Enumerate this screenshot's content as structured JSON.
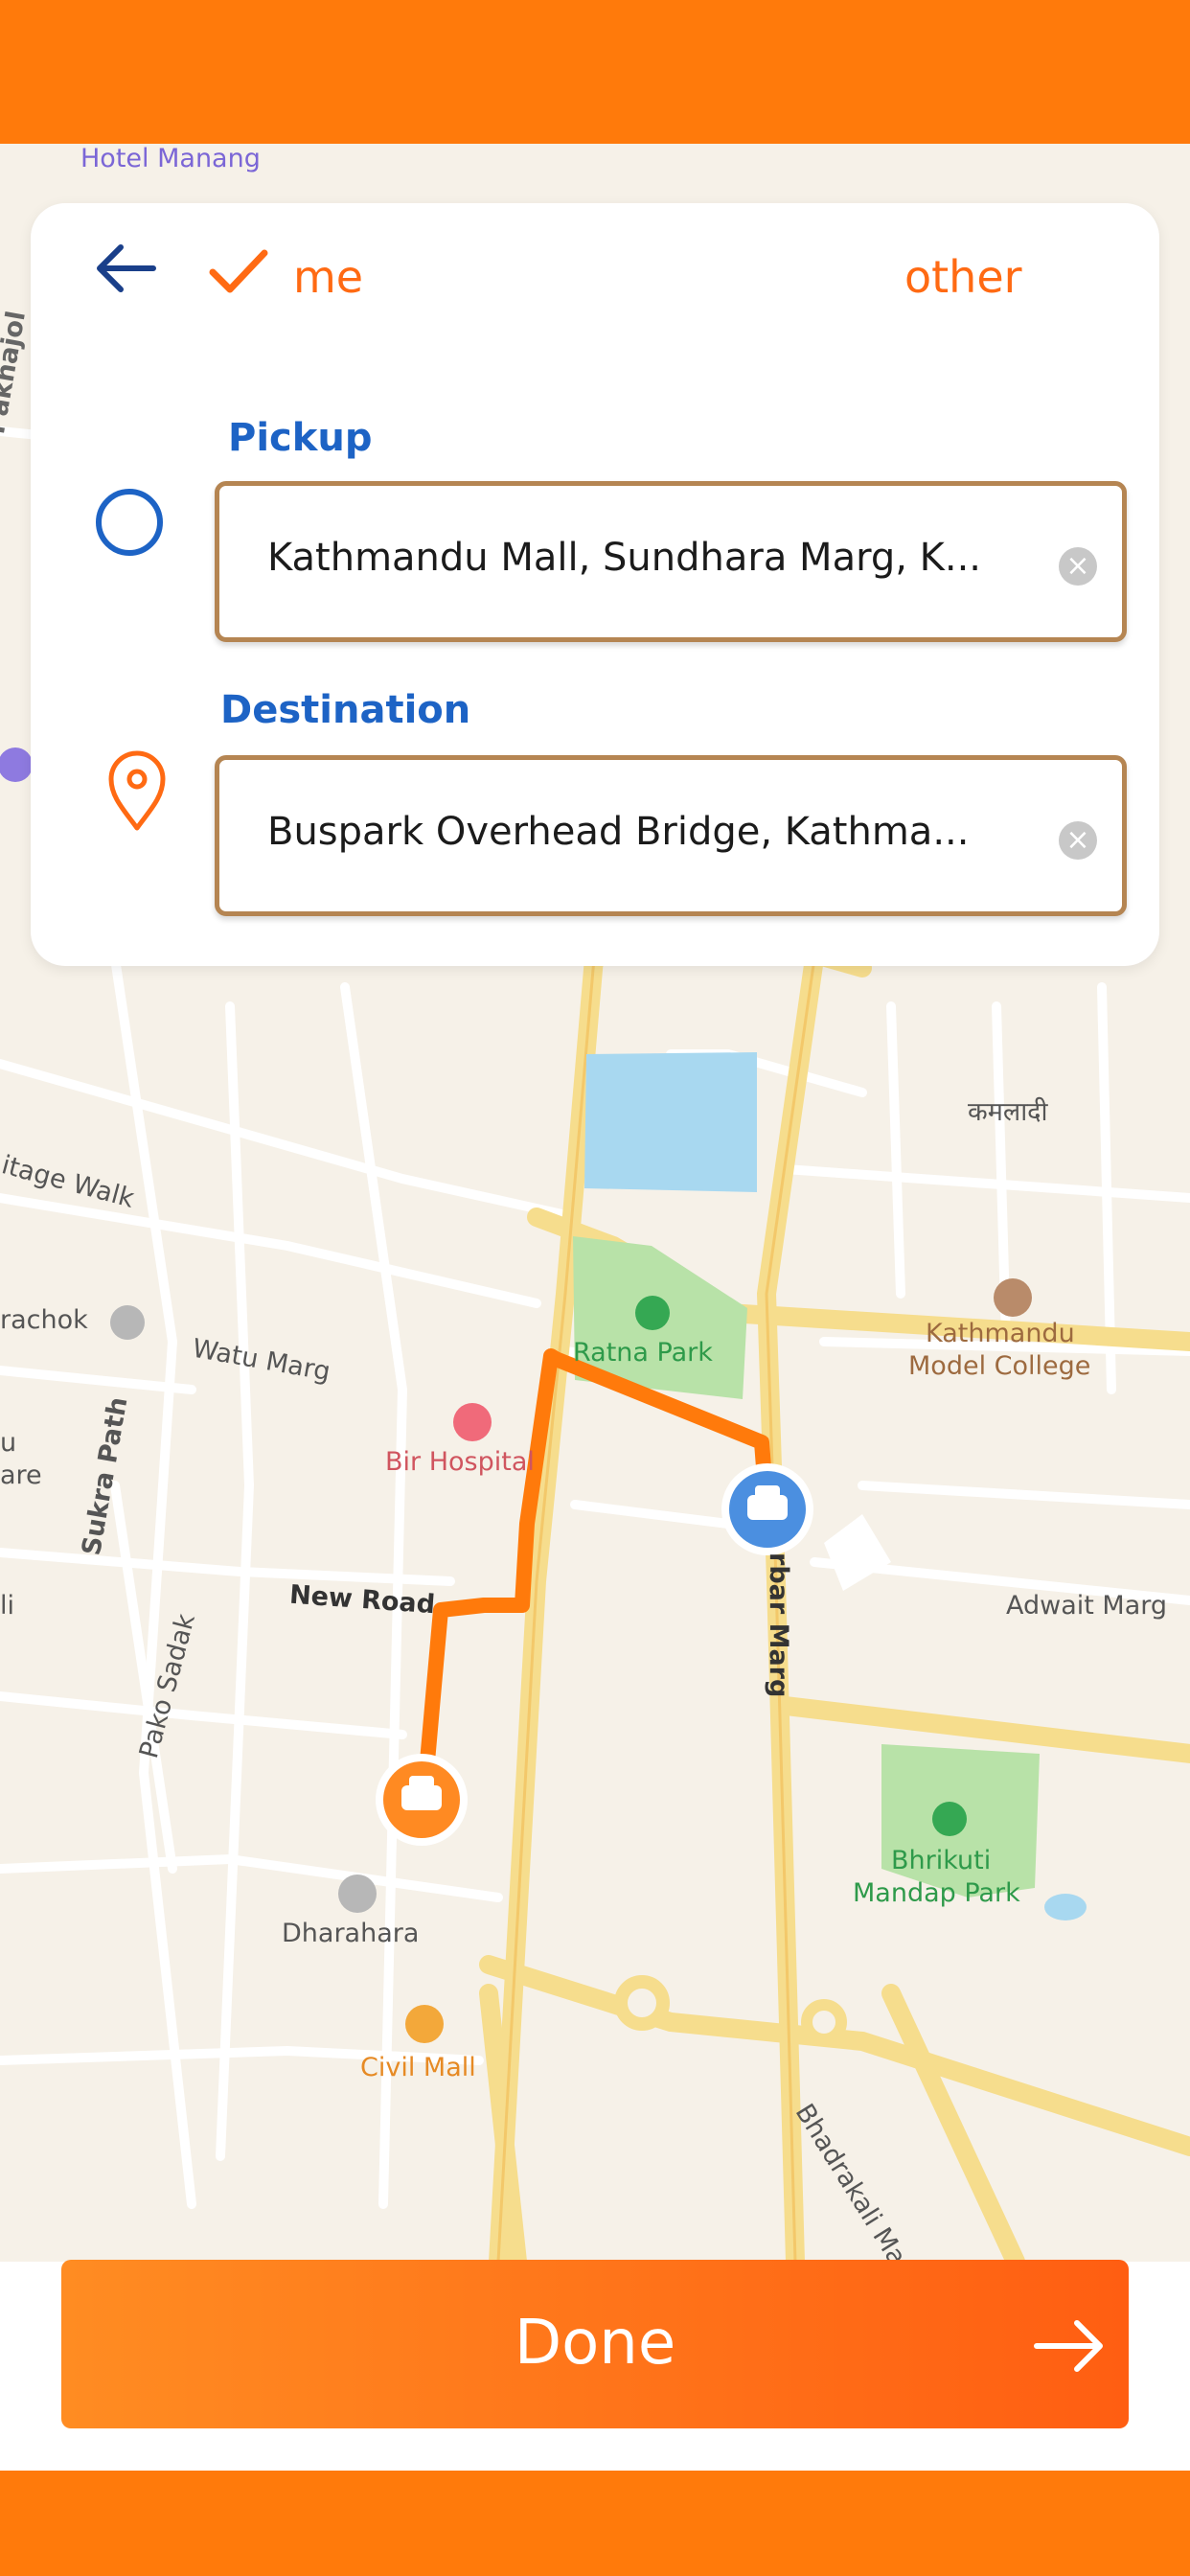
{
  "nav": {
    "back_icon": "arrow-left-icon"
  },
  "toggle": {
    "me_label": "me",
    "other_label": "other",
    "check_icon": "checkmark-icon"
  },
  "pickup": {
    "title": "Pickup",
    "value": "Kathmandu Mall, Sundhara Marg, K...",
    "icon": "circle-icon"
  },
  "destination": {
    "title": "Destination",
    "value": "Buspark Overhead Bridge, Kathma...",
    "icon": "location-pin-icon"
  },
  "map": {
    "labels": {
      "hotel_manang": "Hotel Manang",
      "paknajol": "Paknajol",
      "heritage_walk": "itage Walk",
      "indrachok": "rachok",
      "watu_marg": "Watu Marg",
      "sukra_path": "Sukra Path",
      "bir_hospital": "Bir Hospital",
      "ratna_park": "Ratna Park",
      "new_road": "New Road",
      "pako_sadak": "Pako Sadak",
      "dharahara": "Dharahara",
      "civil_mall": "Civil Mall",
      "durbar_marg": "rbar Marg",
      "adwait_marg": "Adwait Marg",
      "bhrikuti_1": "Bhrikuti",
      "bhrikuti_2": "Mandap Park",
      "kathmandu_model_1": "Kathmandu",
      "kathmandu_model_2": "Model College",
      "kamaladi": "कमलादी",
      "bhadrakali": "Bhadrakali Mar",
      "left_edge_1": "u",
      "left_edge_2": "are",
      "left_edge_3": "li"
    }
  },
  "button": {
    "done_label": "Done",
    "arrow_icon": "arrow-right-icon"
  },
  "colors": {
    "accent": "#ff7a0b",
    "blue": "#1d63c5",
    "route": "#ff7a0b"
  }
}
